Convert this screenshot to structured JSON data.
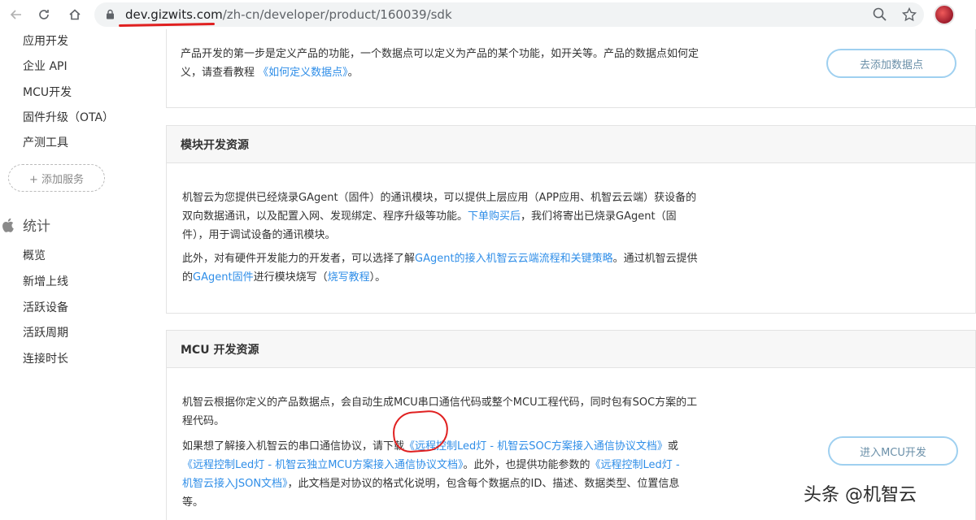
{
  "browser": {
    "url_domain": "dev.gizwits.com",
    "url_path": "/zh-cn/developer/product/160039/sdk"
  },
  "sidebar": {
    "items_top": [
      "应用开发",
      "企业 API",
      "MCU开发",
      "固件升级（OTA）",
      "产测工具"
    ],
    "add_service": "+ 添加服务",
    "stats_label": "统计",
    "stats_items": [
      "概览",
      "新增上线",
      "活跃设备",
      "活跃周期",
      "连接时长"
    ]
  },
  "top_card": {
    "text1": "产品开发的第一步是定义产品的功能，一个数据点可以定义为产品的某个功能，如开关等。产品的数据点如何定",
    "text2_prefix": "义，请查看教程 ",
    "text2_link": "《如何定义数据点》",
    "text2_suffix": "。",
    "button": "去添加数据点"
  },
  "module_card": {
    "title": "模块开发资源",
    "p1_a": "机智云为您提供已经烧录GAgent（固件）的通讯模块，可以提供上层应用（APP应用、机智云云端）获设备的",
    "p1_b": "双向数据通讯，以及配置入网、发现绑定、程序升级等功能。",
    "p1_link": "下单购买后",
    "p1_c": "，我们将寄出已烧录GAgent（固",
    "p1_d": "件），用于调试设备的通讯模块。",
    "p2_a": "此外，对有硬件开发能力的开发者，可以选择了解",
    "p2_link1": "GAgent的接入机智云云端流程和关键策略",
    "p2_b": "。通过机智云提供",
    "p2_c": "的",
    "p2_link2": "GAgent固件",
    "p2_d": "进行模块烧写（",
    "p2_link3": "烧写教程",
    "p2_e": "）。"
  },
  "mcu_card": {
    "title": "MCU 开发资源",
    "p1_a": "机智云根据你定义的产品数据点，会自动生成MCU串口通信代码或整个MCU工程代码，同时包有SOC方案的工",
    "p1_b": "程代码。",
    "p2_a": "如果想了解接入机智云的串口通信协议，",
    "p2_b": "请下载",
    "p2_link1": "《远程控制Led灯 - 机智云SOC方案接入通信协议文档》",
    "p2_c": "或",
    "p2_link2": "《远程控制Led灯 - 机智云独立MCU方案接入通信协议文档》",
    "p2_d": "。此外，也提供功能参数的",
    "p2_link3": "《远程控制Led灯 -",
    "p2_link4": "机智云接入JSON文档》",
    "p2_e": "，此文档是对协议的格式化说明，包含每个数据点的ID、描述、数据类型、位置信息",
    "p2_f": "等。",
    "button": "进入MCU开发"
  },
  "watermark": "头条 @机智云",
  "colors": {
    "link": "#2f8ee8",
    "annotation_red": "#e02020",
    "button_border": "#9fd0f0"
  }
}
